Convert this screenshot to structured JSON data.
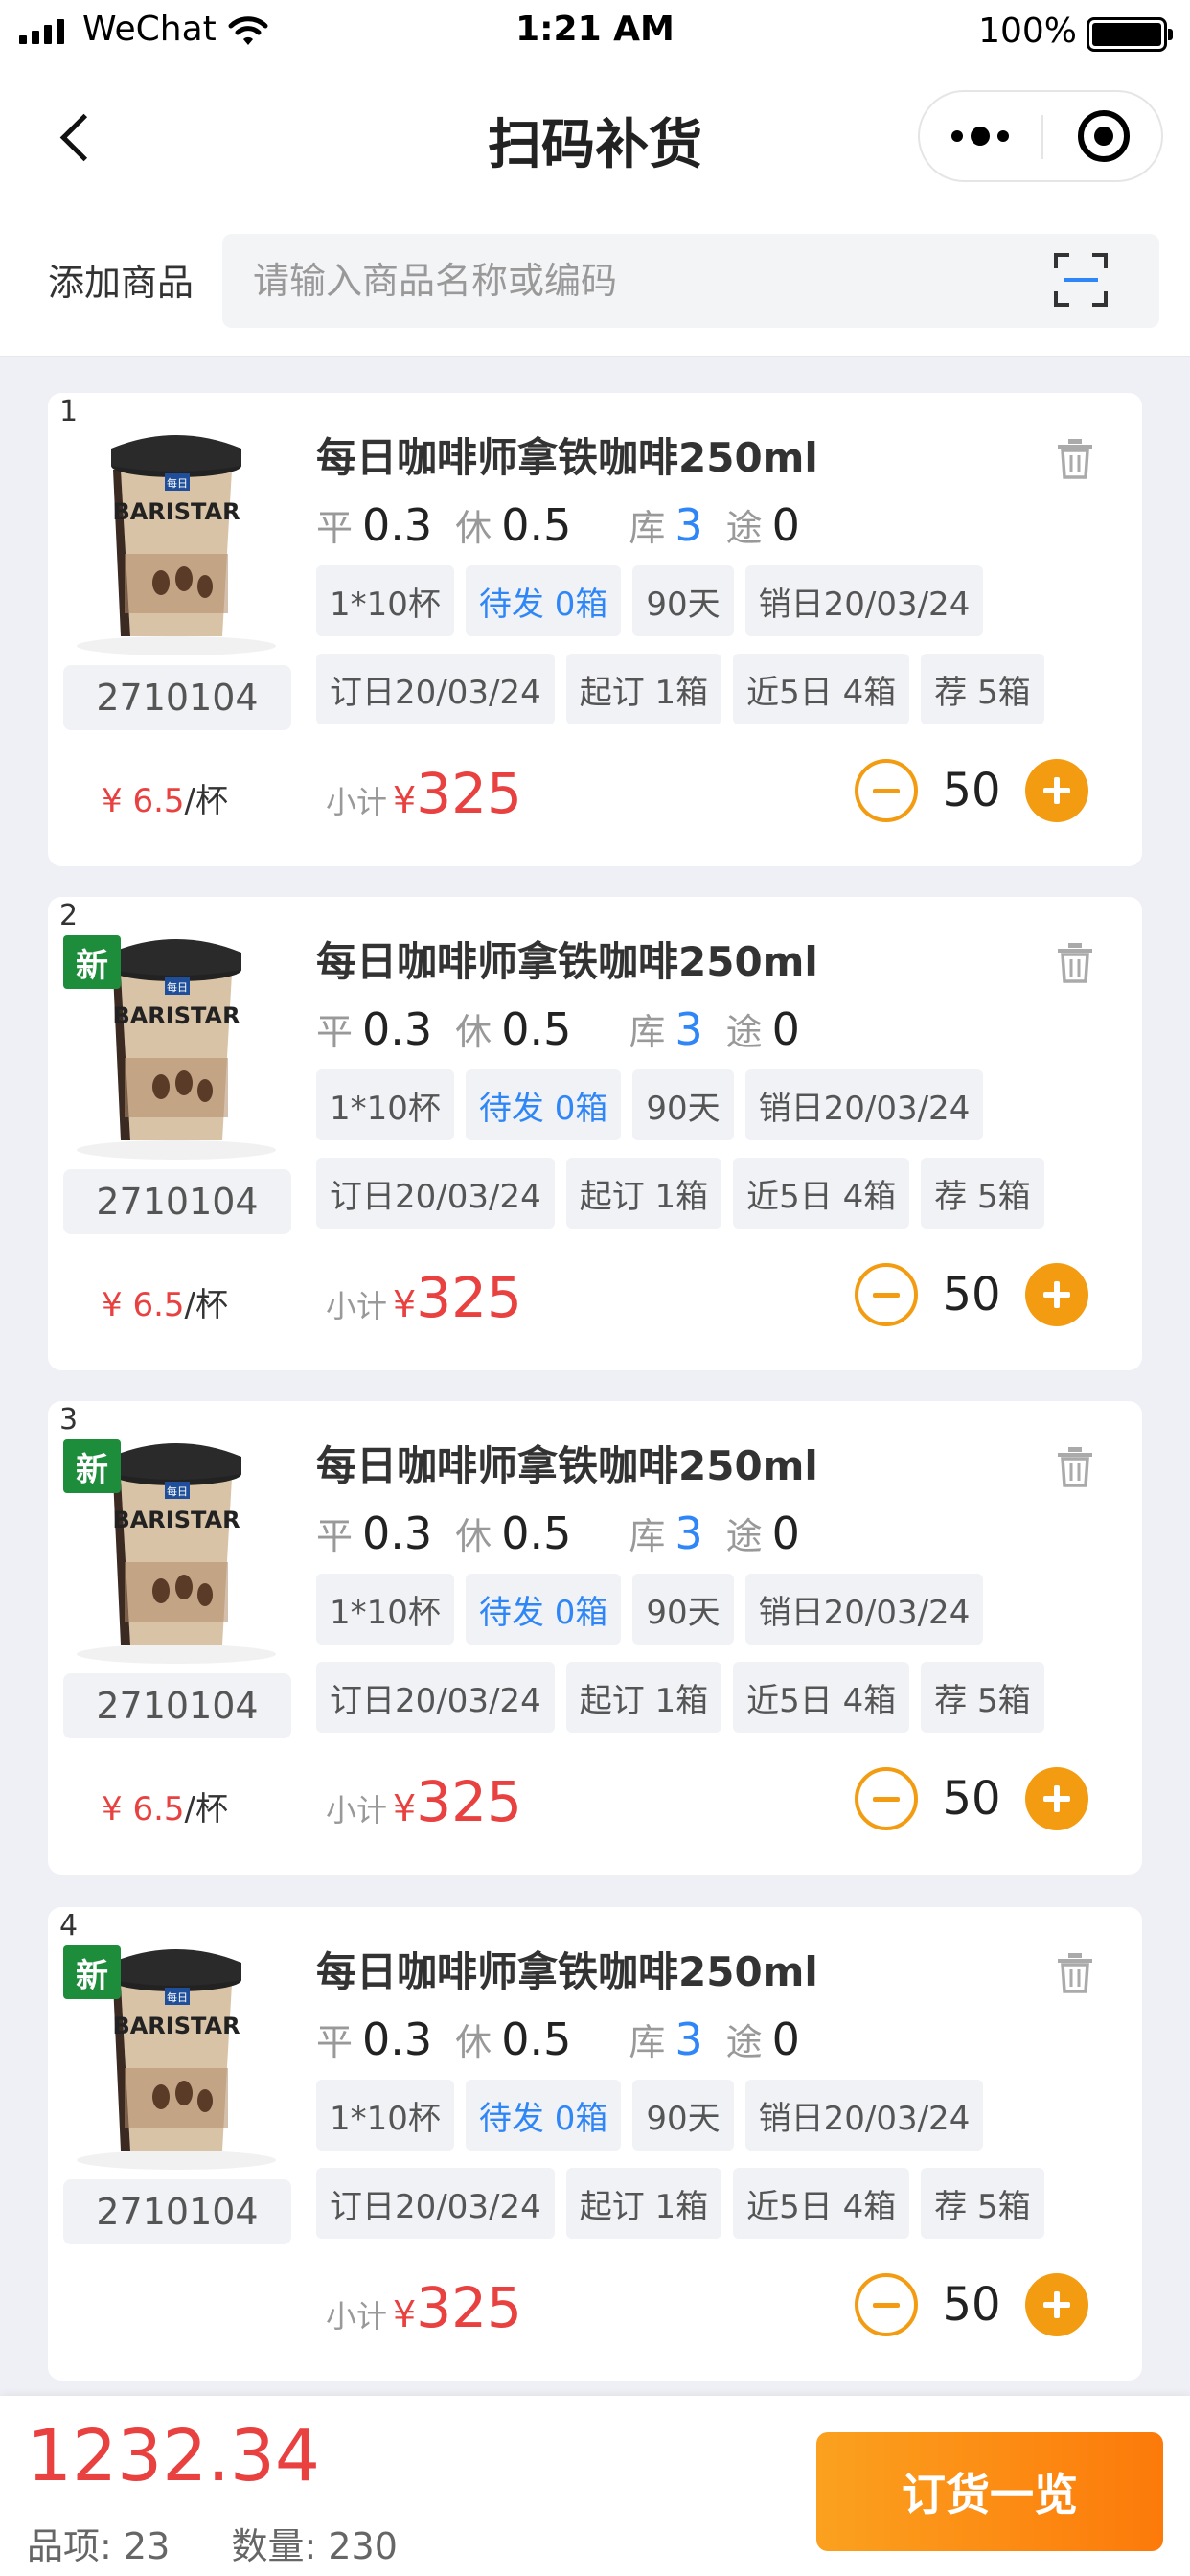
{
  "status_bar": {
    "carrier": "WeChat",
    "time": "1:21 AM",
    "battery": "100%"
  },
  "nav": {
    "title": "扫码补货"
  },
  "search": {
    "label": "添加商品",
    "placeholder": "请输入商品名称或编码"
  },
  "colors": {
    "accent_orange": "#f39c12",
    "price_red": "#e94040",
    "badge_green": "#1d8c3b",
    "info_blue": "#2f86f6"
  },
  "icons": [
    "chevron-left-icon",
    "more-dots-icon",
    "close-circle-icon",
    "scan-icon",
    "trash-icon",
    "minus-icon",
    "plus-icon"
  ],
  "items": [
    {
      "index": "1",
      "new_badge": "",
      "title": "每日咖啡师拿铁咖啡250ml",
      "code": "2710104",
      "price_value": "¥ 6.5",
      "price_unit": "/杯",
      "stats": {
        "ping_label": "平",
        "ping": "0.3",
        "xiu_label": "休",
        "xiu": "0.5",
        "ku_label": "库",
        "ku": "3",
        "tu_label": "途",
        "tu": "0"
      },
      "tags_row1": [
        "1*10杯",
        "待发 0箱",
        "90天",
        "销日20/03/24"
      ],
      "tags_row2": [
        "订日20/03/24",
        "起订 1箱",
        "近5日 4箱",
        "荐 5箱"
      ],
      "subtotal_label": "小计",
      "currency": "¥",
      "subtotal": "325",
      "qty": "50"
    },
    {
      "index": "2",
      "new_badge": "新",
      "title": "每日咖啡师拿铁咖啡250ml",
      "code": "2710104",
      "price_value": "¥ 6.5",
      "price_unit": "/杯",
      "stats": {
        "ping_label": "平",
        "ping": "0.3",
        "xiu_label": "休",
        "xiu": "0.5",
        "ku_label": "库",
        "ku": "3",
        "tu_label": "途",
        "tu": "0"
      },
      "tags_row1": [
        "1*10杯",
        "待发 0箱",
        "90天",
        "销日20/03/24"
      ],
      "tags_row2": [
        "订日20/03/24",
        "起订 1箱",
        "近5日 4箱",
        "荐 5箱"
      ],
      "subtotal_label": "小计",
      "currency": "¥",
      "subtotal": "325",
      "qty": "50"
    },
    {
      "index": "3",
      "new_badge": "新",
      "title": "每日咖啡师拿铁咖啡250ml",
      "code": "2710104",
      "price_value": "¥ 6.5",
      "price_unit": "/杯",
      "stats": {
        "ping_label": "平",
        "ping": "0.3",
        "xiu_label": "休",
        "xiu": "0.5",
        "ku_label": "库",
        "ku": "3",
        "tu_label": "途",
        "tu": "0"
      },
      "tags_row1": [
        "1*10杯",
        "待发 0箱",
        "90天",
        "销日20/03/24"
      ],
      "tags_row2": [
        "订日20/03/24",
        "起订 1箱",
        "近5日 4箱",
        "荐 5箱"
      ],
      "subtotal_label": "小计",
      "currency": "¥",
      "subtotal": "325",
      "qty": "50"
    },
    {
      "index": "4",
      "new_badge": "新",
      "title": "每日咖啡师拿铁咖啡250ml",
      "code": "2710104",
      "price_value": "",
      "price_unit": "",
      "stats": {
        "ping_label": "平",
        "ping": "0.3",
        "xiu_label": "休",
        "xiu": "0.5",
        "ku_label": "库",
        "ku": "3",
        "tu_label": "途",
        "tu": "0"
      },
      "tags_row1": [
        "1*10杯",
        "待发 0箱",
        "90天",
        "销日20/03/24"
      ],
      "tags_row2": [
        "订日20/03/24",
        "起订 1箱",
        "近5日 4箱",
        "荐 5箱"
      ],
      "subtotal_label": "小计",
      "currency": "¥",
      "subtotal": "325",
      "qty": "50"
    }
  ],
  "product_image": {
    "brand_top": "每日",
    "brand_name": "BARISTAR"
  },
  "footer": {
    "total": "1232.34",
    "items_label": "品项:",
    "items_count": "23",
    "qty_label": "数量:",
    "qty_count": "230",
    "order_button": "订货一览"
  }
}
